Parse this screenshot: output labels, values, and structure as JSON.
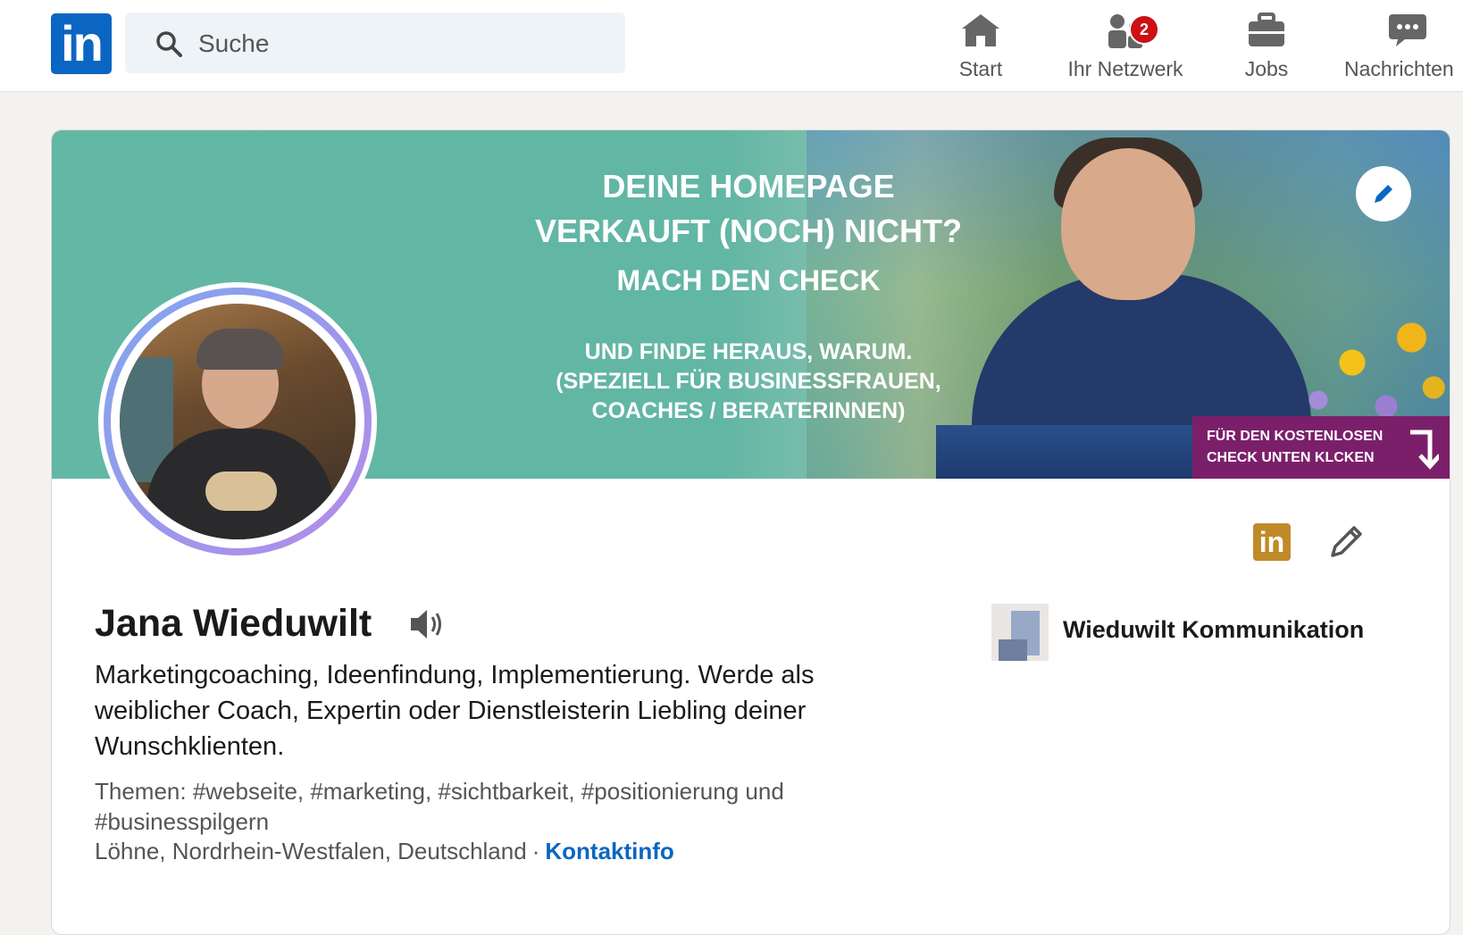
{
  "nav": {
    "search_placeholder": "Suche",
    "items": [
      {
        "label": "Start",
        "icon": "home-icon"
      },
      {
        "label": "Ihr Netzwerk",
        "icon": "network-icon",
        "badge": "2"
      },
      {
        "label": "Jobs",
        "icon": "briefcase-icon"
      },
      {
        "label": "Nachrichten",
        "icon": "messaging-icon"
      }
    ]
  },
  "banner": {
    "line1": "DEINE HOMEPAGE",
    "line2": "VERKAUFT (NOCH) NICHT?",
    "line3": "MACH DEN CHECK",
    "line4": "UND FINDE HERAUS, WARUM.",
    "line5": "(SPEZIELL FÜR BUSINESSFRAUEN,",
    "line6": "COACHES / BERATERINNEN)",
    "cta_line1": "FÜR DEN KOSTENLOSEN",
    "cta_line2": "CHECK UNTEN KLCKEN"
  },
  "profile": {
    "name": "Jana Wieduwilt",
    "headline": "Marketingcoaching, Ideenfindung, Implementierung. Werde als weiblicher Coach, Expertin oder Dienstleisterin Liebling deiner Wunschklienten.",
    "topics": "Themen: #webseite, #marketing, #sichtbarkeit, #positionierung und #businesspilgern",
    "location": "Löhne, Nordrhein-Westfalen, Deutschland",
    "separator": "·",
    "contact_link": "Kontaktinfo",
    "company": "Wieduwilt Kommunikation"
  },
  "colors": {
    "brand": "#0a66c2",
    "banner_green": "#63b7a5",
    "cta_purple": "#7b1f6b",
    "badge_red": "#cc1016"
  }
}
